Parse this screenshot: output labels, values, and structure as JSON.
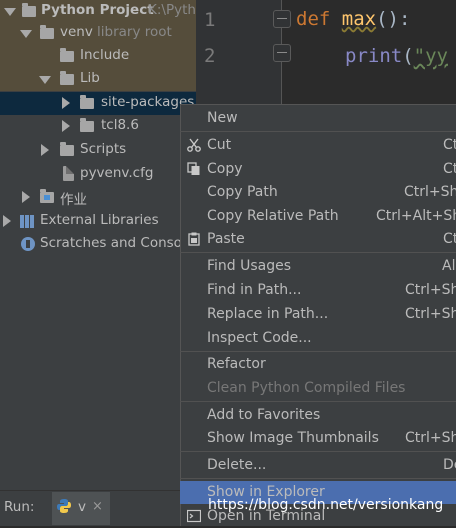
{
  "project_tree": {
    "project": {
      "name": "Python Project",
      "path": "K:\\Pytho"
    },
    "venv": {
      "name": "venv",
      "suffix": "library root"
    },
    "include": "Include",
    "lib": "Lib",
    "site_packages": "site-packages",
    "tcl": "tcl8.6",
    "scripts": "Scripts",
    "pyvenv": "pyvenv.cfg",
    "homework": "作业",
    "external_libraries": "External Libraries",
    "scratches": "Scratches and Consol"
  },
  "editor": {
    "line_numbers": [
      "1",
      "2"
    ],
    "line1": {
      "kw": "def",
      "fn": "max",
      "rest": "():"
    },
    "line2": {
      "builtin": "print",
      "paren": "(",
      "str": "\"yy"
    }
  },
  "run_bar": {
    "label": "Run:",
    "tab": "v",
    "close": "×"
  },
  "context_menu": {
    "items": [
      {
        "label": "New",
        "shortcut": ""
      },
      {
        "label": "Cut",
        "shortcut": "Ct"
      },
      {
        "label": "Copy",
        "shortcut": "Ct"
      },
      {
        "label": "Copy Path",
        "shortcut": "Ctrl+Shi"
      },
      {
        "label": "Copy Relative Path",
        "shortcut": "Ctrl+Alt+Shi"
      },
      {
        "label": "Paste",
        "shortcut": "Ct"
      },
      {
        "label": "Find Usages",
        "shortcut": "Al"
      },
      {
        "label": "Find in Path...",
        "shortcut": "Ctrl+Sh"
      },
      {
        "label": "Replace in Path...",
        "shortcut": "Ctrl+Sh"
      },
      {
        "label": "Inspect Code...",
        "shortcut": ""
      },
      {
        "label": "Refactor",
        "shortcut": ""
      },
      {
        "label": "Clean Python Compiled Files",
        "shortcut": ""
      },
      {
        "label": "Add to Favorites",
        "shortcut": ""
      },
      {
        "label": "Show Image Thumbnails",
        "shortcut": "Ctrl+Shi"
      },
      {
        "label": "Delete...",
        "shortcut": "De"
      },
      {
        "label": "Show in Explorer",
        "shortcut": ""
      },
      {
        "label": "Open in Terminal",
        "shortcut": ""
      }
    ]
  },
  "watermark": "https://blog.csdn.net/versionkang"
}
